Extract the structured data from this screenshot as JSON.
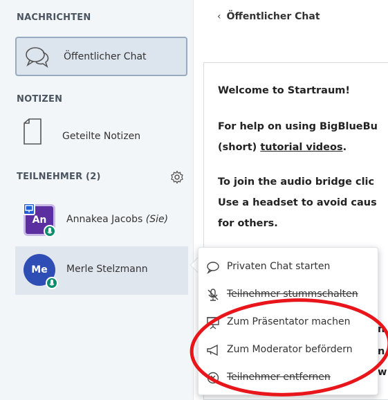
{
  "sidebar": {
    "messages_title": "NACHRICHTEN",
    "public_chat_label": "Öffentlicher Chat",
    "notes_title": "NOTIZEN",
    "shared_notes_label": "Geteilte Notizen",
    "participants_title": "TEILNEHMER (2)",
    "users": [
      {
        "initials": "An",
        "name": "Annakea Jacobs",
        "suffix": "(Sie)",
        "avatar_color": "#5b2fa0"
      },
      {
        "initials": "Me",
        "name": "Merle Stelzmann",
        "suffix": "",
        "avatar_color": "#2f4eb5"
      }
    ]
  },
  "chat": {
    "header": "Öffentlicher Chat",
    "lines": {
      "l1a": "Welcome to ",
      "l1b": "Startraum",
      "l1c": "!",
      "l2": "For help on using BigBlueBu",
      "l3a": "(short) ",
      "l3b": "tutorial videos",
      "l3c": ".",
      "l4": "To join the audio bridge clic",
      "l5": "Use a headset to avoid caus",
      "l6": "for others."
    },
    "behind_fragments": {
      "a": "n",
      "b": "n",
      "c": "w"
    }
  },
  "context_menu": {
    "items": [
      {
        "label": "Privaten Chat starten",
        "icon": "chat-bubble-icon"
      },
      {
        "label": "Teilnehmer stummschalten",
        "icon": "mic-off-icon"
      },
      {
        "label": "Zum Präsentator machen",
        "icon": "presentation-icon"
      },
      {
        "label": "Zum Moderator befördern",
        "icon": "megaphone-icon"
      },
      {
        "label": "Teilnehmer entfernen",
        "icon": "remove-circle-icon"
      }
    ]
  },
  "colors": {
    "annotation": "#e8151b",
    "mic_badge": "#0f8c6e"
  }
}
